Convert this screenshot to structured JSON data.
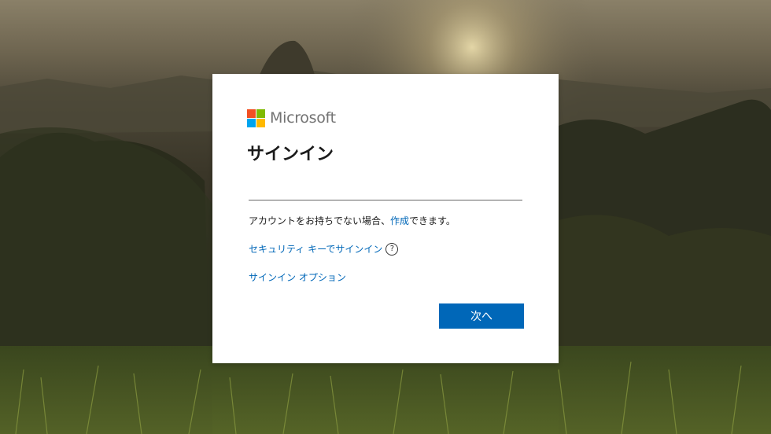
{
  "brand": {
    "name": "Microsoft",
    "logo_icon": "microsoft-logo-icon",
    "colors": {
      "red": "#f25022",
      "green": "#7fba00",
      "blue": "#00a4ef",
      "yellow": "#ffb900"
    }
  },
  "signin": {
    "title": "サインイン",
    "email_value": "",
    "email_placeholder": "",
    "no_account_prefix": "アカウントをお持ちでない場合、",
    "create_link": "作成",
    "no_account_suffix": "できます。",
    "security_key_link": "セキュリティ キーでサインイン",
    "help_icon": "question-circle-icon",
    "help_glyph": "?",
    "options_link": "サインイン オプション",
    "next_button": "次へ"
  },
  "colors": {
    "accent": "#0067b8",
    "text": "#1b1b1b"
  }
}
